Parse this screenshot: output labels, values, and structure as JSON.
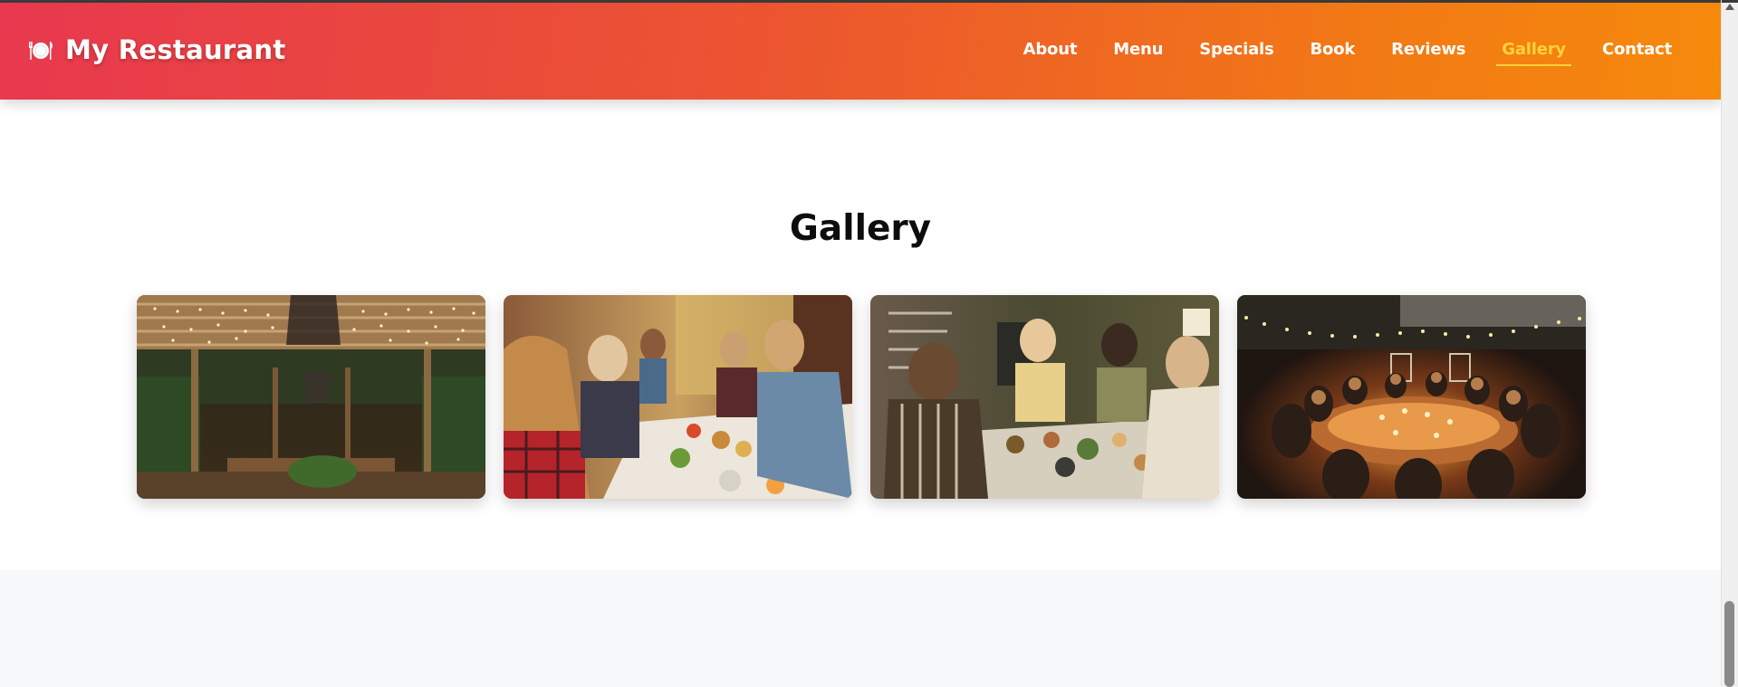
{
  "header": {
    "brand_icon": "plate-cutlery-icon",
    "brand_name": "My Restaurant",
    "nav": [
      {
        "label": "About",
        "active": false
      },
      {
        "label": "Menu",
        "active": false
      },
      {
        "label": "Specials",
        "active": false
      },
      {
        "label": "Book",
        "active": false
      },
      {
        "label": "Reviews",
        "active": false
      },
      {
        "label": "Gallery",
        "active": true
      },
      {
        "label": "Contact",
        "active": false
      }
    ],
    "gradient_colors": [
      "#e8384f",
      "#f68a0c"
    ],
    "active_color": "#ffd23a"
  },
  "gallery": {
    "title": "Gallery",
    "images": [
      {
        "icon": "pergola-string-lights-photo"
      },
      {
        "icon": "friends-dining-table-photo"
      },
      {
        "icon": "family-dinner-home-photo"
      },
      {
        "icon": "outdoor-evening-feast-photo"
      }
    ]
  }
}
